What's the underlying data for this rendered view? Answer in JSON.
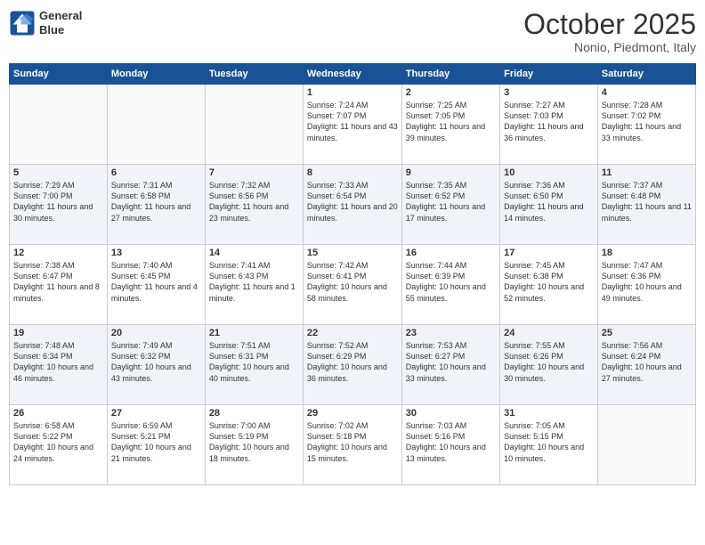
{
  "header": {
    "logo_line1": "General",
    "logo_line2": "Blue",
    "month": "October 2025",
    "location": "Nonio, Piedmont, Italy"
  },
  "days_of_week": [
    "Sunday",
    "Monday",
    "Tuesday",
    "Wednesday",
    "Thursday",
    "Friday",
    "Saturday"
  ],
  "weeks": [
    [
      {
        "num": "",
        "empty": true
      },
      {
        "num": "",
        "empty": true
      },
      {
        "num": "",
        "empty": true
      },
      {
        "num": "1",
        "sunrise": "7:24 AM",
        "sunset": "7:07 PM",
        "daylight": "11 hours and 43 minutes."
      },
      {
        "num": "2",
        "sunrise": "7:25 AM",
        "sunset": "7:05 PM",
        "daylight": "11 hours and 39 minutes."
      },
      {
        "num": "3",
        "sunrise": "7:27 AM",
        "sunset": "7:03 PM",
        "daylight": "11 hours and 36 minutes."
      },
      {
        "num": "4",
        "sunrise": "7:28 AM",
        "sunset": "7:02 PM",
        "daylight": "11 hours and 33 minutes."
      }
    ],
    [
      {
        "num": "5",
        "sunrise": "7:29 AM",
        "sunset": "7:00 PM",
        "daylight": "11 hours and 30 minutes."
      },
      {
        "num": "6",
        "sunrise": "7:31 AM",
        "sunset": "6:58 PM",
        "daylight": "11 hours and 27 minutes."
      },
      {
        "num": "7",
        "sunrise": "7:32 AM",
        "sunset": "6:56 PM",
        "daylight": "11 hours and 23 minutes."
      },
      {
        "num": "8",
        "sunrise": "7:33 AM",
        "sunset": "6:54 PM",
        "daylight": "11 hours and 20 minutes."
      },
      {
        "num": "9",
        "sunrise": "7:35 AM",
        "sunset": "6:52 PM",
        "daylight": "11 hours and 17 minutes."
      },
      {
        "num": "10",
        "sunrise": "7:36 AM",
        "sunset": "6:50 PM",
        "daylight": "11 hours and 14 minutes."
      },
      {
        "num": "11",
        "sunrise": "7:37 AM",
        "sunset": "6:48 PM",
        "daylight": "11 hours and 11 minutes."
      }
    ],
    [
      {
        "num": "12",
        "sunrise": "7:38 AM",
        "sunset": "6:47 PM",
        "daylight": "11 hours and 8 minutes."
      },
      {
        "num": "13",
        "sunrise": "7:40 AM",
        "sunset": "6:45 PM",
        "daylight": "11 hours and 4 minutes."
      },
      {
        "num": "14",
        "sunrise": "7:41 AM",
        "sunset": "6:43 PM",
        "daylight": "11 hours and 1 minute."
      },
      {
        "num": "15",
        "sunrise": "7:42 AM",
        "sunset": "6:41 PM",
        "daylight": "10 hours and 58 minutes."
      },
      {
        "num": "16",
        "sunrise": "7:44 AM",
        "sunset": "6:39 PM",
        "daylight": "10 hours and 55 minutes."
      },
      {
        "num": "17",
        "sunrise": "7:45 AM",
        "sunset": "6:38 PM",
        "daylight": "10 hours and 52 minutes."
      },
      {
        "num": "18",
        "sunrise": "7:47 AM",
        "sunset": "6:36 PM",
        "daylight": "10 hours and 49 minutes."
      }
    ],
    [
      {
        "num": "19",
        "sunrise": "7:48 AM",
        "sunset": "6:34 PM",
        "daylight": "10 hours and 46 minutes."
      },
      {
        "num": "20",
        "sunrise": "7:49 AM",
        "sunset": "6:32 PM",
        "daylight": "10 hours and 43 minutes."
      },
      {
        "num": "21",
        "sunrise": "7:51 AM",
        "sunset": "6:31 PM",
        "daylight": "10 hours and 40 minutes."
      },
      {
        "num": "22",
        "sunrise": "7:52 AM",
        "sunset": "6:29 PM",
        "daylight": "10 hours and 36 minutes."
      },
      {
        "num": "23",
        "sunrise": "7:53 AM",
        "sunset": "6:27 PM",
        "daylight": "10 hours and 33 minutes."
      },
      {
        "num": "24",
        "sunrise": "7:55 AM",
        "sunset": "6:26 PM",
        "daylight": "10 hours and 30 minutes."
      },
      {
        "num": "25",
        "sunrise": "7:56 AM",
        "sunset": "6:24 PM",
        "daylight": "10 hours and 27 minutes."
      }
    ],
    [
      {
        "num": "26",
        "sunrise": "6:58 AM",
        "sunset": "5:22 PM",
        "daylight": "10 hours and 24 minutes."
      },
      {
        "num": "27",
        "sunrise": "6:59 AM",
        "sunset": "5:21 PM",
        "daylight": "10 hours and 21 minutes."
      },
      {
        "num": "28",
        "sunrise": "7:00 AM",
        "sunset": "5:19 PM",
        "daylight": "10 hours and 18 minutes."
      },
      {
        "num": "29",
        "sunrise": "7:02 AM",
        "sunset": "5:18 PM",
        "daylight": "10 hours and 15 minutes."
      },
      {
        "num": "30",
        "sunrise": "7:03 AM",
        "sunset": "5:16 PM",
        "daylight": "10 hours and 13 minutes."
      },
      {
        "num": "31",
        "sunrise": "7:05 AM",
        "sunset": "5:15 PM",
        "daylight": "10 hours and 10 minutes."
      },
      {
        "num": "",
        "empty": true
      }
    ]
  ]
}
